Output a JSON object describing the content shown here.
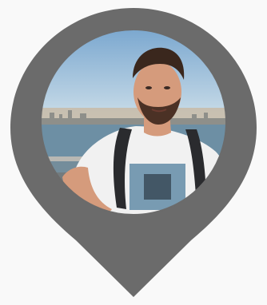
{
  "marker": {
    "pin_color": "#6b6b6b",
    "background_color": "#f9f9f9",
    "photo": {
      "description_hidden": true,
      "sky_top": "#7aa7cf",
      "sky_bottom": "#cfe0ea",
      "horizon": "#c9b59a",
      "water": "#6d8fa4",
      "city": "#8e8f8a",
      "shirt": "#f1f1f1",
      "skin": "#d59b7c",
      "hair": "#3a271d",
      "beard": "#4b3125",
      "strap": "#2a2b2e",
      "railing": "#b9b8b3"
    }
  }
}
